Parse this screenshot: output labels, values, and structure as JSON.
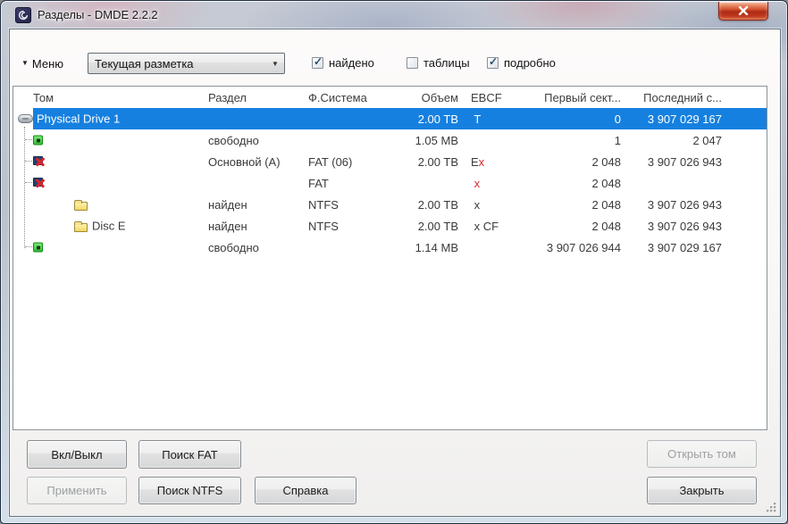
{
  "window": {
    "title": "Разделы - DMDE 2.2.2"
  },
  "icons": {
    "app_logo": "dmde-swirl",
    "close": "x-cross",
    "menu_arrow": "▾",
    "combo_arrow": "▼",
    "checkmark": "✓"
  },
  "colors": {
    "selection": "#1680e0",
    "ebcf_error": "#dc262d",
    "close_button": "#c03a1e"
  },
  "toolbar": {
    "menu_label": "Меню",
    "layout_select": {
      "value": "Текущая разметка"
    },
    "checkboxes": [
      {
        "label": "найдено",
        "checked": true
      },
      {
        "label": "таблицы",
        "checked": false
      },
      {
        "label": "подробно",
        "checked": true
      }
    ]
  },
  "table": {
    "columns": [
      {
        "label": "Том"
      },
      {
        "label": "Раздел"
      },
      {
        "label": "Ф.Система"
      },
      {
        "label": "Объем"
      },
      {
        "label": "EBCF"
      },
      {
        "label": "Первый сект..."
      },
      {
        "label": "Последний с..."
      }
    ],
    "rows": [
      {
        "icon": "drive",
        "indent": "root",
        "tom": "Physical Drive 1",
        "razdel": "",
        "fs": "",
        "size": "2.00 TB",
        "ebcf": [
          {
            "text": " T",
            "red": false
          }
        ],
        "first": "0",
        "last": "3 907 029 167",
        "selected": true
      },
      {
        "icon": "free",
        "indent": "child",
        "tom": "",
        "razdel": "свободно",
        "fs": "",
        "size": "1.05 MB",
        "ebcf": [],
        "first": "1",
        "last": "2 047"
      },
      {
        "icon": "delx",
        "indent": "child",
        "tom": "",
        "razdel": "Основной (A)",
        "fs": "FAT (06)",
        "size": "2.00 TB",
        "ebcf": [
          {
            "text": "E",
            "red": false
          },
          {
            "text": "x",
            "red": true
          }
        ],
        "first": "2 048",
        "last": "3 907 026 943"
      },
      {
        "icon": "delx",
        "indent": "child",
        "tom": "",
        "razdel": "",
        "fs": "FAT",
        "size": "",
        "ebcf": [
          {
            "text": " x",
            "red": true
          }
        ],
        "first": "2 048",
        "last": ""
      },
      {
        "icon": "folder",
        "indent": "deep",
        "tom": "",
        "razdel": "найден",
        "fs": "NTFS",
        "size": "2.00 TB",
        "ebcf": [
          {
            "text": " x",
            "red": false
          }
        ],
        "first": "2 048",
        "last": "3 907 026 943"
      },
      {
        "icon": "folder",
        "indent": "deep",
        "tom": "Disc E",
        "razdel": "найден",
        "fs": "NTFS",
        "size": "2.00 TB",
        "ebcf": [
          {
            "text": " x CF",
            "red": false
          }
        ],
        "first": "2 048",
        "last": "3 907 026 943"
      },
      {
        "icon": "free",
        "indent": "child",
        "tom": "",
        "razdel": "свободно",
        "fs": "",
        "size": "1.14 MB",
        "ebcf": [],
        "first": "3 907 026 944",
        "last": "3 907 029 167"
      }
    ]
  },
  "buttons": {
    "toggle": {
      "label": "Вкл/Выкл",
      "enabled": true
    },
    "search_fat": {
      "label": "Поиск FAT",
      "enabled": true
    },
    "apply": {
      "label": "Применить",
      "enabled": false
    },
    "search_ntfs": {
      "label": "Поиск NTFS",
      "enabled": true
    },
    "help": {
      "label": "Справка",
      "enabled": true
    },
    "open_volume": {
      "label": "Открыть том",
      "enabled": false
    },
    "close": {
      "label": "Закрыть",
      "enabled": true
    }
  }
}
